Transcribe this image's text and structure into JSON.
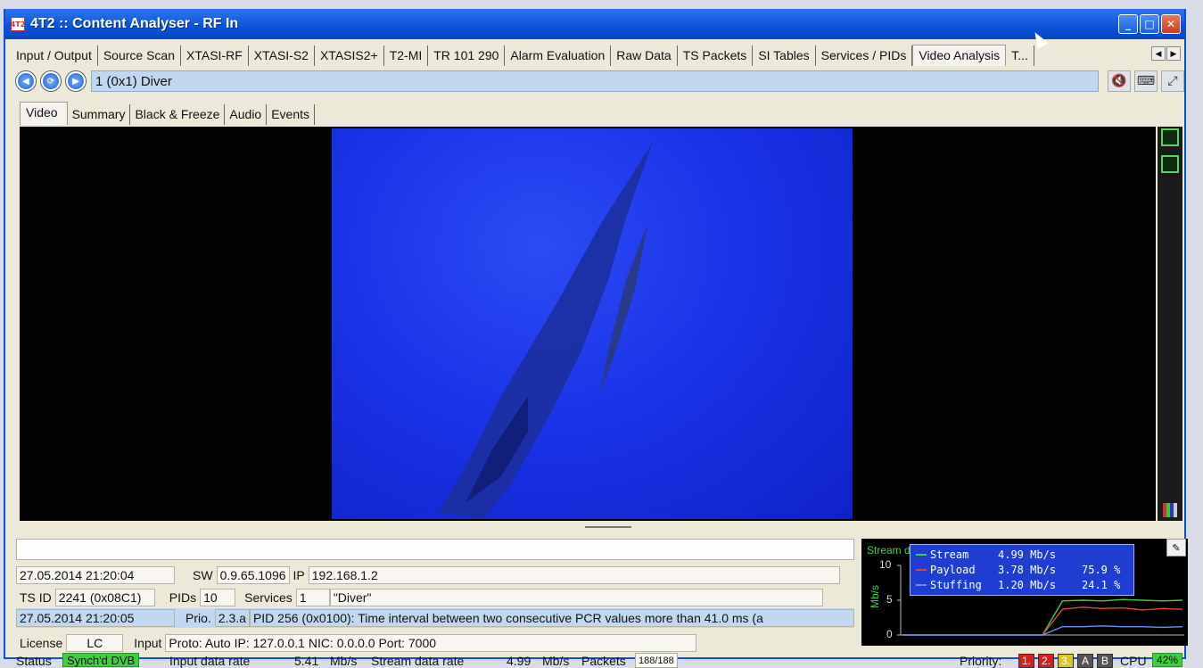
{
  "window": {
    "title": "4T2 :: Content Analyser - RF In",
    "icon": "app-logo-icon",
    "controls": [
      "minimize-icon",
      "maximize-icon",
      "close-icon"
    ]
  },
  "tabs": [
    {
      "label": "Input / Output"
    },
    {
      "label": "Source Scan"
    },
    {
      "label": "XTASI-RF"
    },
    {
      "label": "XTASI-S2"
    },
    {
      "label": "XTASIS2+"
    },
    {
      "label": "T2-MI"
    },
    {
      "label": "TR 101 290"
    },
    {
      "label": "Alarm Evaluation"
    },
    {
      "label": "Raw Data"
    },
    {
      "label": "TS Packets"
    },
    {
      "label": "SI Tables"
    },
    {
      "label": "Services / PIDs"
    },
    {
      "label": "Video Analysis",
      "active": true
    },
    {
      "label": "T..."
    }
  ],
  "service": {
    "selected": "1 (0x1) Diver"
  },
  "subtabs": [
    {
      "label": "Video",
      "active": true
    },
    {
      "label": "Summary"
    },
    {
      "label": "Black & Freeze"
    },
    {
      "label": "Audio"
    },
    {
      "label": "Events"
    }
  ],
  "info": {
    "row1": {
      "datetime": "27.05.2014 21:20:04",
      "sw_label": "SW",
      "sw_value": "0.9.65.1096",
      "ip_label": "IP",
      "ip_value": "192.168.1.2"
    },
    "row2": {
      "tsid_label": "TS ID",
      "tsid_value": "2241 (0x08C1)",
      "pids_label": "PIDs",
      "pids_value": "10",
      "services_label": "Services",
      "services_value": "1",
      "service_name": "\"Diver\""
    },
    "row3": {
      "datetime": "27.05.2014 21:20:05",
      "prio_label": "Prio.",
      "prio_value": "2.3.a",
      "message": "PID 256 (0x0100): Time interval between two consecutive PCR values more than 41.0 ms (a"
    },
    "row4": {
      "license_label": "License",
      "license_value": "LC",
      "input_label": "Input",
      "input_value": "Proto: Auto IP: 127.0.0.1 NIC: 0.0.0.0 Port: 7000"
    }
  },
  "chart_data": {
    "type": "line",
    "title": "Stream data rate",
    "ylabel": "Mb/s",
    "ylim": [
      0,
      10
    ],
    "yticks": [
      "10",
      "5",
      "0"
    ],
    "series": [
      {
        "name": "Stream",
        "value": "4.99",
        "unit": "Mb/s",
        "percent": "",
        "color": "#3ecf3e",
        "values": [
          0,
          0,
          0,
          0,
          0,
          0,
          0,
          0,
          4.9,
          5.0,
          4.9,
          5.1,
          5.0,
          4.9,
          5.0
        ]
      },
      {
        "name": "Payload",
        "value": "3.78",
        "unit": "Mb/s",
        "percent": "75.9 %",
        "color": "#e0463c",
        "values": [
          0,
          0,
          0,
          0,
          0,
          0,
          0,
          0,
          3.7,
          4.0,
          3.8,
          3.9,
          3.6,
          3.8,
          3.7
        ]
      },
      {
        "name": "Stuffing",
        "value": "1.20",
        "unit": "Mb/s",
        "percent": "24.1 %",
        "color": "#6a8cff",
        "values": [
          0,
          0,
          0,
          0,
          0,
          0,
          0,
          0,
          1.2,
          1.2,
          1.3,
          1.2,
          1.2,
          1.1,
          1.2
        ]
      }
    ]
  },
  "status": {
    "status_label": "Status",
    "status_value": "Synch'd DVB",
    "input_rate_label": "Input data rate",
    "input_rate_value": "5.41",
    "input_rate_unit": "Mb/s",
    "stream_rate_label": "Stream data rate",
    "stream_rate_value": "4.99",
    "stream_rate_unit": "Mb/s",
    "packets_label": "Packets",
    "packets_value": "188/188",
    "priority_label": "Priority:",
    "priorities": [
      {
        "label": "1.",
        "color": "#d62020"
      },
      {
        "label": "2.",
        "color": "#d62020"
      },
      {
        "label": "3.",
        "color": "#d6c820"
      },
      {
        "label": "A",
        "color": "#555555"
      },
      {
        "label": "B",
        "color": "#555555"
      }
    ],
    "cpu_label": "CPU",
    "cpu_value": "42%"
  }
}
